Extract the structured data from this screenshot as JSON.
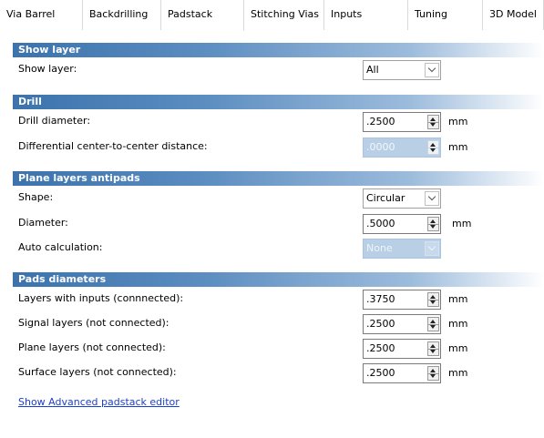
{
  "tabs": [
    {
      "label": "Via Barrel"
    },
    {
      "label": "Backdrilling"
    },
    {
      "label": "Padstack"
    },
    {
      "label": "Stitching Vias"
    },
    {
      "label": "Inputs"
    },
    {
      "label": "Tuning"
    },
    {
      "label": "3D Model"
    }
  ],
  "active_tab": "Padstack",
  "sections": {
    "show_layer": {
      "header": "Show layer",
      "label": "Show layer:",
      "value": "All"
    },
    "drill": {
      "header": "Drill",
      "diameter_label": "Drill diameter:",
      "diameter_value": ".2500",
      "diameter_unit": "mm",
      "ctc_label": "Differential center-to-center distance:",
      "ctc_value": ".0000",
      "ctc_unit": "mm"
    },
    "antipads": {
      "header": "Plane layers antipads",
      "shape_label": "Shape:",
      "shape_value": "Circular",
      "diameter_label": "Diameter:",
      "diameter_value": ".5000",
      "diameter_unit": "mm",
      "auto_label": "Auto calculation:",
      "auto_value": "None"
    },
    "pads": {
      "header": "Pads diameters",
      "rows": [
        {
          "label": "Layers with inputs (connnected):",
          "value": ".3750",
          "unit": "mm"
        },
        {
          "label": "Signal layers (not connected):",
          "value": ".2500",
          "unit": "mm"
        },
        {
          "label": "Plane layers (not connected):",
          "value": ".2500",
          "unit": "mm"
        },
        {
          "label": "Surface layers (not connected):",
          "value": ".2500",
          "unit": "mm"
        }
      ]
    }
  },
  "link_text": "Show Advanced padstack editor",
  "colors": {
    "header_gradient_start": "#3c73ad",
    "disabled_fill": "#b8cfe6",
    "link": "#1a3fd1"
  },
  "icons": [
    "spin-up-icon",
    "spin-down-icon",
    "chevron-down-icon"
  ]
}
